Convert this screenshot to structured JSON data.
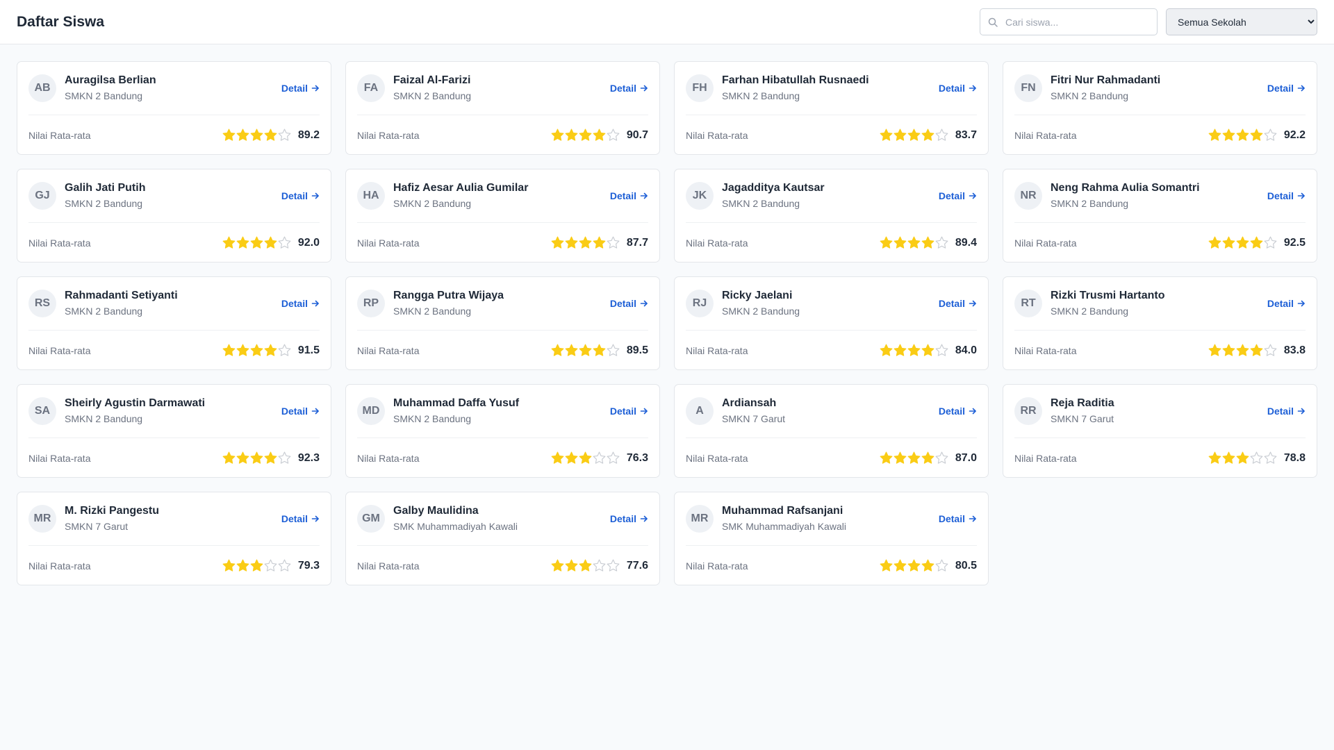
{
  "header": {
    "title": "Daftar Siswa",
    "search_placeholder": "Cari siswa...",
    "school_filter": "Semua Sekolah"
  },
  "labels": {
    "detail": "Detail",
    "average": "Nilai Rata-rata"
  },
  "colors": {
    "accent": "#1d5fd6",
    "star_filled": "#facc15",
    "star_empty": "#c8ccd2"
  },
  "students": [
    {
      "initials": "AB",
      "name": "Auragilsa Berlian",
      "school": "SMKN 2 Bandung",
      "stars": 4,
      "score": "89.2"
    },
    {
      "initials": "FA",
      "name": "Faizal Al-Farizi",
      "school": "SMKN 2 Bandung",
      "stars": 4,
      "score": "90.7"
    },
    {
      "initials": "FH",
      "name": "Farhan Hibatullah Rusnaedi",
      "school": "SMKN 2 Bandung",
      "stars": 4,
      "score": "83.7"
    },
    {
      "initials": "FN",
      "name": "Fitri Nur Rahmadanti",
      "school": "SMKN 2 Bandung",
      "stars": 4,
      "score": "92.2"
    },
    {
      "initials": "GJ",
      "name": "Galih Jati Putih",
      "school": "SMKN 2 Bandung",
      "stars": 4,
      "score": "92.0"
    },
    {
      "initials": "HA",
      "name": "Hafiz Aesar Aulia Gumilar",
      "school": "SMKN 2 Bandung",
      "stars": 4,
      "score": "87.7"
    },
    {
      "initials": "JK",
      "name": "Jagadditya Kautsar",
      "school": "SMKN 2 Bandung",
      "stars": 4,
      "score": "89.4"
    },
    {
      "initials": "NR",
      "name": "Neng Rahma Aulia Somantri",
      "school": "SMKN 2 Bandung",
      "stars": 4,
      "score": "92.5"
    },
    {
      "initials": "RS",
      "name": "Rahmadanti Setiyanti",
      "school": "SMKN 2 Bandung",
      "stars": 4,
      "score": "91.5"
    },
    {
      "initials": "RP",
      "name": "Rangga Putra Wijaya",
      "school": "SMKN 2 Bandung",
      "stars": 4,
      "score": "89.5"
    },
    {
      "initials": "RJ",
      "name": "Ricky Jaelani",
      "school": "SMKN 2 Bandung",
      "stars": 4,
      "score": "84.0"
    },
    {
      "initials": "RT",
      "name": "Rizki Trusmi Hartanto",
      "school": "SMKN 2 Bandung",
      "stars": 4,
      "score": "83.8"
    },
    {
      "initials": "SA",
      "name": "Sheirly Agustin Darmawati",
      "school": "SMKN 2 Bandung",
      "stars": 4,
      "score": "92.3"
    },
    {
      "initials": "MD",
      "name": "Muhammad Daffa Yusuf",
      "school": "SMKN 2 Bandung",
      "stars": 3,
      "score": "76.3"
    },
    {
      "initials": "A",
      "name": "Ardiansah",
      "school": "SMKN 7 Garut",
      "stars": 4,
      "score": "87.0"
    },
    {
      "initials": "RR",
      "name": "Reja Raditia",
      "school": "SMKN 7 Garut",
      "stars": 3,
      "score": "78.8"
    },
    {
      "initials": "MR",
      "name": "M. Rizki Pangestu",
      "school": "SMKN 7 Garut",
      "stars": 3,
      "score": "79.3"
    },
    {
      "initials": "GM",
      "name": "Galby Maulidina",
      "school": "SMK Muhammadiyah Kawali",
      "stars": 3,
      "score": "77.6"
    },
    {
      "initials": "MR",
      "name": "Muhammad Rafsanjani",
      "school": "SMK Muhammadiyah Kawali",
      "stars": 4,
      "score": "80.5"
    }
  ]
}
